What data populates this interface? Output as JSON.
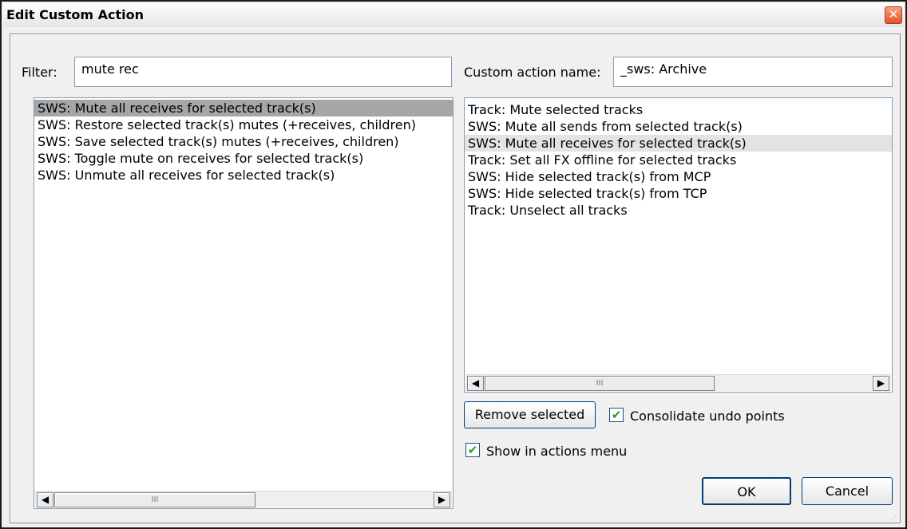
{
  "window": {
    "title": "Edit Custom Action",
    "close_glyph": "✕"
  },
  "filter": {
    "label": "Filter:",
    "value": "mute rec"
  },
  "custom_action": {
    "label": "Custom action name:",
    "value": "_sws: Archive"
  },
  "left_list": {
    "items": [
      "SWS: Mute all receives for selected track(s)",
      "SWS: Restore selected track(s) mutes (+receives, children)",
      "SWS: Save selected track(s) mutes (+receives, children)",
      "SWS: Toggle mute on receives for selected track(s)",
      "SWS: Unmute all receives for selected track(s)"
    ],
    "selected_index": 0
  },
  "right_list": {
    "items": [
      "Track: Mute selected tracks",
      "SWS: Mute all sends from selected track(s)",
      "SWS: Mute all receives for selected track(s)",
      "Track: Set all FX offline for selected tracks",
      "SWS: Hide selected track(s) from MCP",
      "SWS: Hide selected track(s) from TCP",
      "Track: Unselect all tracks"
    ],
    "selected_index": 2
  },
  "scrollbar": {
    "left_arrow": "◀",
    "right_arrow": "▶",
    "thumb_grip": "III"
  },
  "buttons": {
    "remove_selected": "Remove selected",
    "ok": "OK",
    "cancel": "Cancel"
  },
  "options": {
    "consolidate_undo": {
      "label": "Consolidate undo points",
      "checked": true
    },
    "show_in_menu": {
      "label": "Show in actions menu",
      "checked": true
    },
    "check_glyph": "✔"
  },
  "colors": {
    "selection_dark": "#a6a6a6",
    "selection_light": "#e3e3e3",
    "close_button": "#e5552c",
    "checkmark": "#21a121"
  }
}
